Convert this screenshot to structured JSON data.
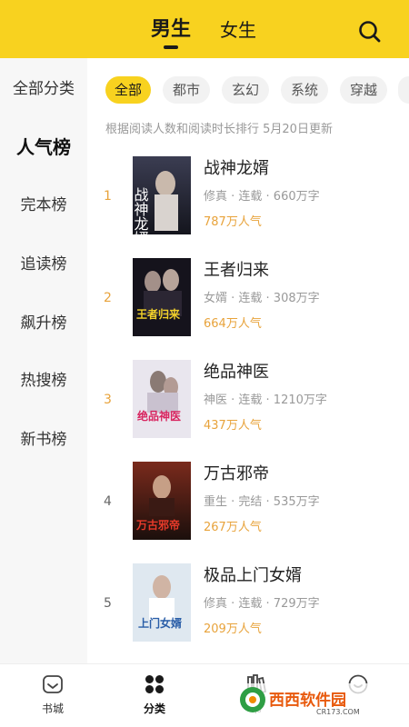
{
  "header": {
    "tabs": [
      "男生",
      "女生"
    ],
    "active_tab": "男生",
    "search_icon": "search-icon",
    "accent_color": "#f8d21f"
  },
  "sidebar": {
    "active_item": "人气榜",
    "items": [
      "全部分类",
      "人气榜",
      "完本榜",
      "追读榜",
      "飙升榜",
      "热搜榜",
      "新书榜"
    ]
  },
  "categories": {
    "active": "全部",
    "items": [
      "全部",
      "都市",
      "玄幻",
      "系统",
      "穿越"
    ]
  },
  "note": "根据阅读人数和阅读时长排行 5月20日更新",
  "books": [
    {
      "rank": "1",
      "title": "战神龙婿",
      "meta": "修真 · 连载 · 660万字",
      "popularity": "787万人气",
      "cover_text": "战神龙婿"
    },
    {
      "rank": "2",
      "title": "王者归来",
      "meta": "女婿 · 连载 · 308万字",
      "popularity": "664万人气",
      "cover_text": "王者归来"
    },
    {
      "rank": "3",
      "title": "绝品神医",
      "meta": "神医 · 连载 · 1210万字",
      "popularity": "437万人气",
      "cover_text": "绝品神医"
    },
    {
      "rank": "4",
      "title": "万古邪帝",
      "meta": "重生 · 完结 · 535万字",
      "popularity": "267万人气",
      "cover_text": "万古邪帝"
    },
    {
      "rank": "5",
      "title": "极品上门女婿",
      "meta": "修真 · 连载 · 729万字",
      "popularity": "209万人气",
      "cover_text": "上门女婿"
    }
  ],
  "bottom_nav": {
    "active": "分类",
    "items": [
      {
        "label": "书城",
        "icon": "bookstore-icon"
      },
      {
        "label": "分类",
        "icon": "category-icon"
      },
      {
        "label": "书",
        "icon": "bookshelf-icon"
      },
      {
        "label": "",
        "icon": "profile-icon"
      }
    ]
  },
  "watermark": {
    "brand": "西西软件园",
    "domain": "CR173.COM"
  }
}
